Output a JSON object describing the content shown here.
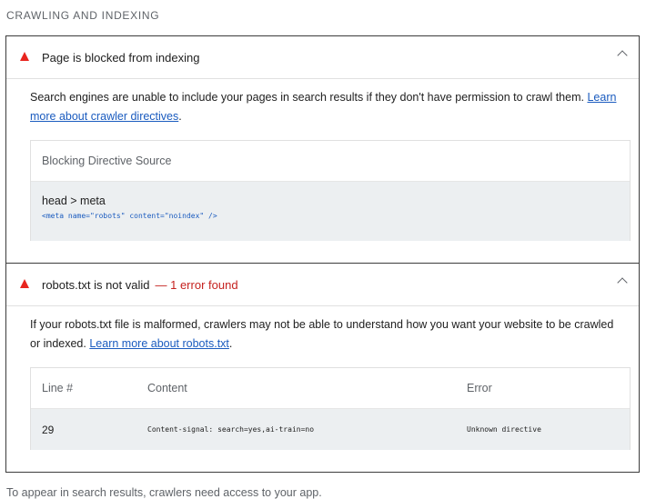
{
  "section": {
    "title": "CRAWLING AND INDEXING"
  },
  "audits": [
    {
      "title": "Page is blocked from indexing",
      "error_suffix": "",
      "description": "Search engines are unable to include your pages in search results if they don't have permission to crawl them.",
      "link_text": "Learn more about crawler directives",
      "table": {
        "header": "Blocking Directive Source",
        "node_path": "head > meta",
        "snippet": "<meta name=\"robots\" content=\"noindex\" />"
      }
    },
    {
      "title": "robots.txt is not valid",
      "error_suffix": "— 1 error found",
      "description": "If your robots.txt file is malformed, crawlers may not be able to understand how you want your website to be crawled or indexed.",
      "link_text": "Learn more about robots.txt",
      "table": {
        "headers": [
          "Line #",
          "Content",
          "Error"
        ],
        "rows": [
          {
            "line": "29",
            "content": "Content-signal: search=yes,ai-train=no",
            "error": "Unknown directive"
          }
        ]
      }
    }
  ],
  "footer": {
    "text": "To appear in search results, crawlers need access to your app."
  },
  "colors": {
    "fail": "#e8251e",
    "link": "#1a5bbf",
    "error_text": "#c5221f",
    "table_body": "#eceff1"
  },
  "icons": {
    "fail": "warning-triangle-icon",
    "expand": "chevron-up-icon"
  }
}
